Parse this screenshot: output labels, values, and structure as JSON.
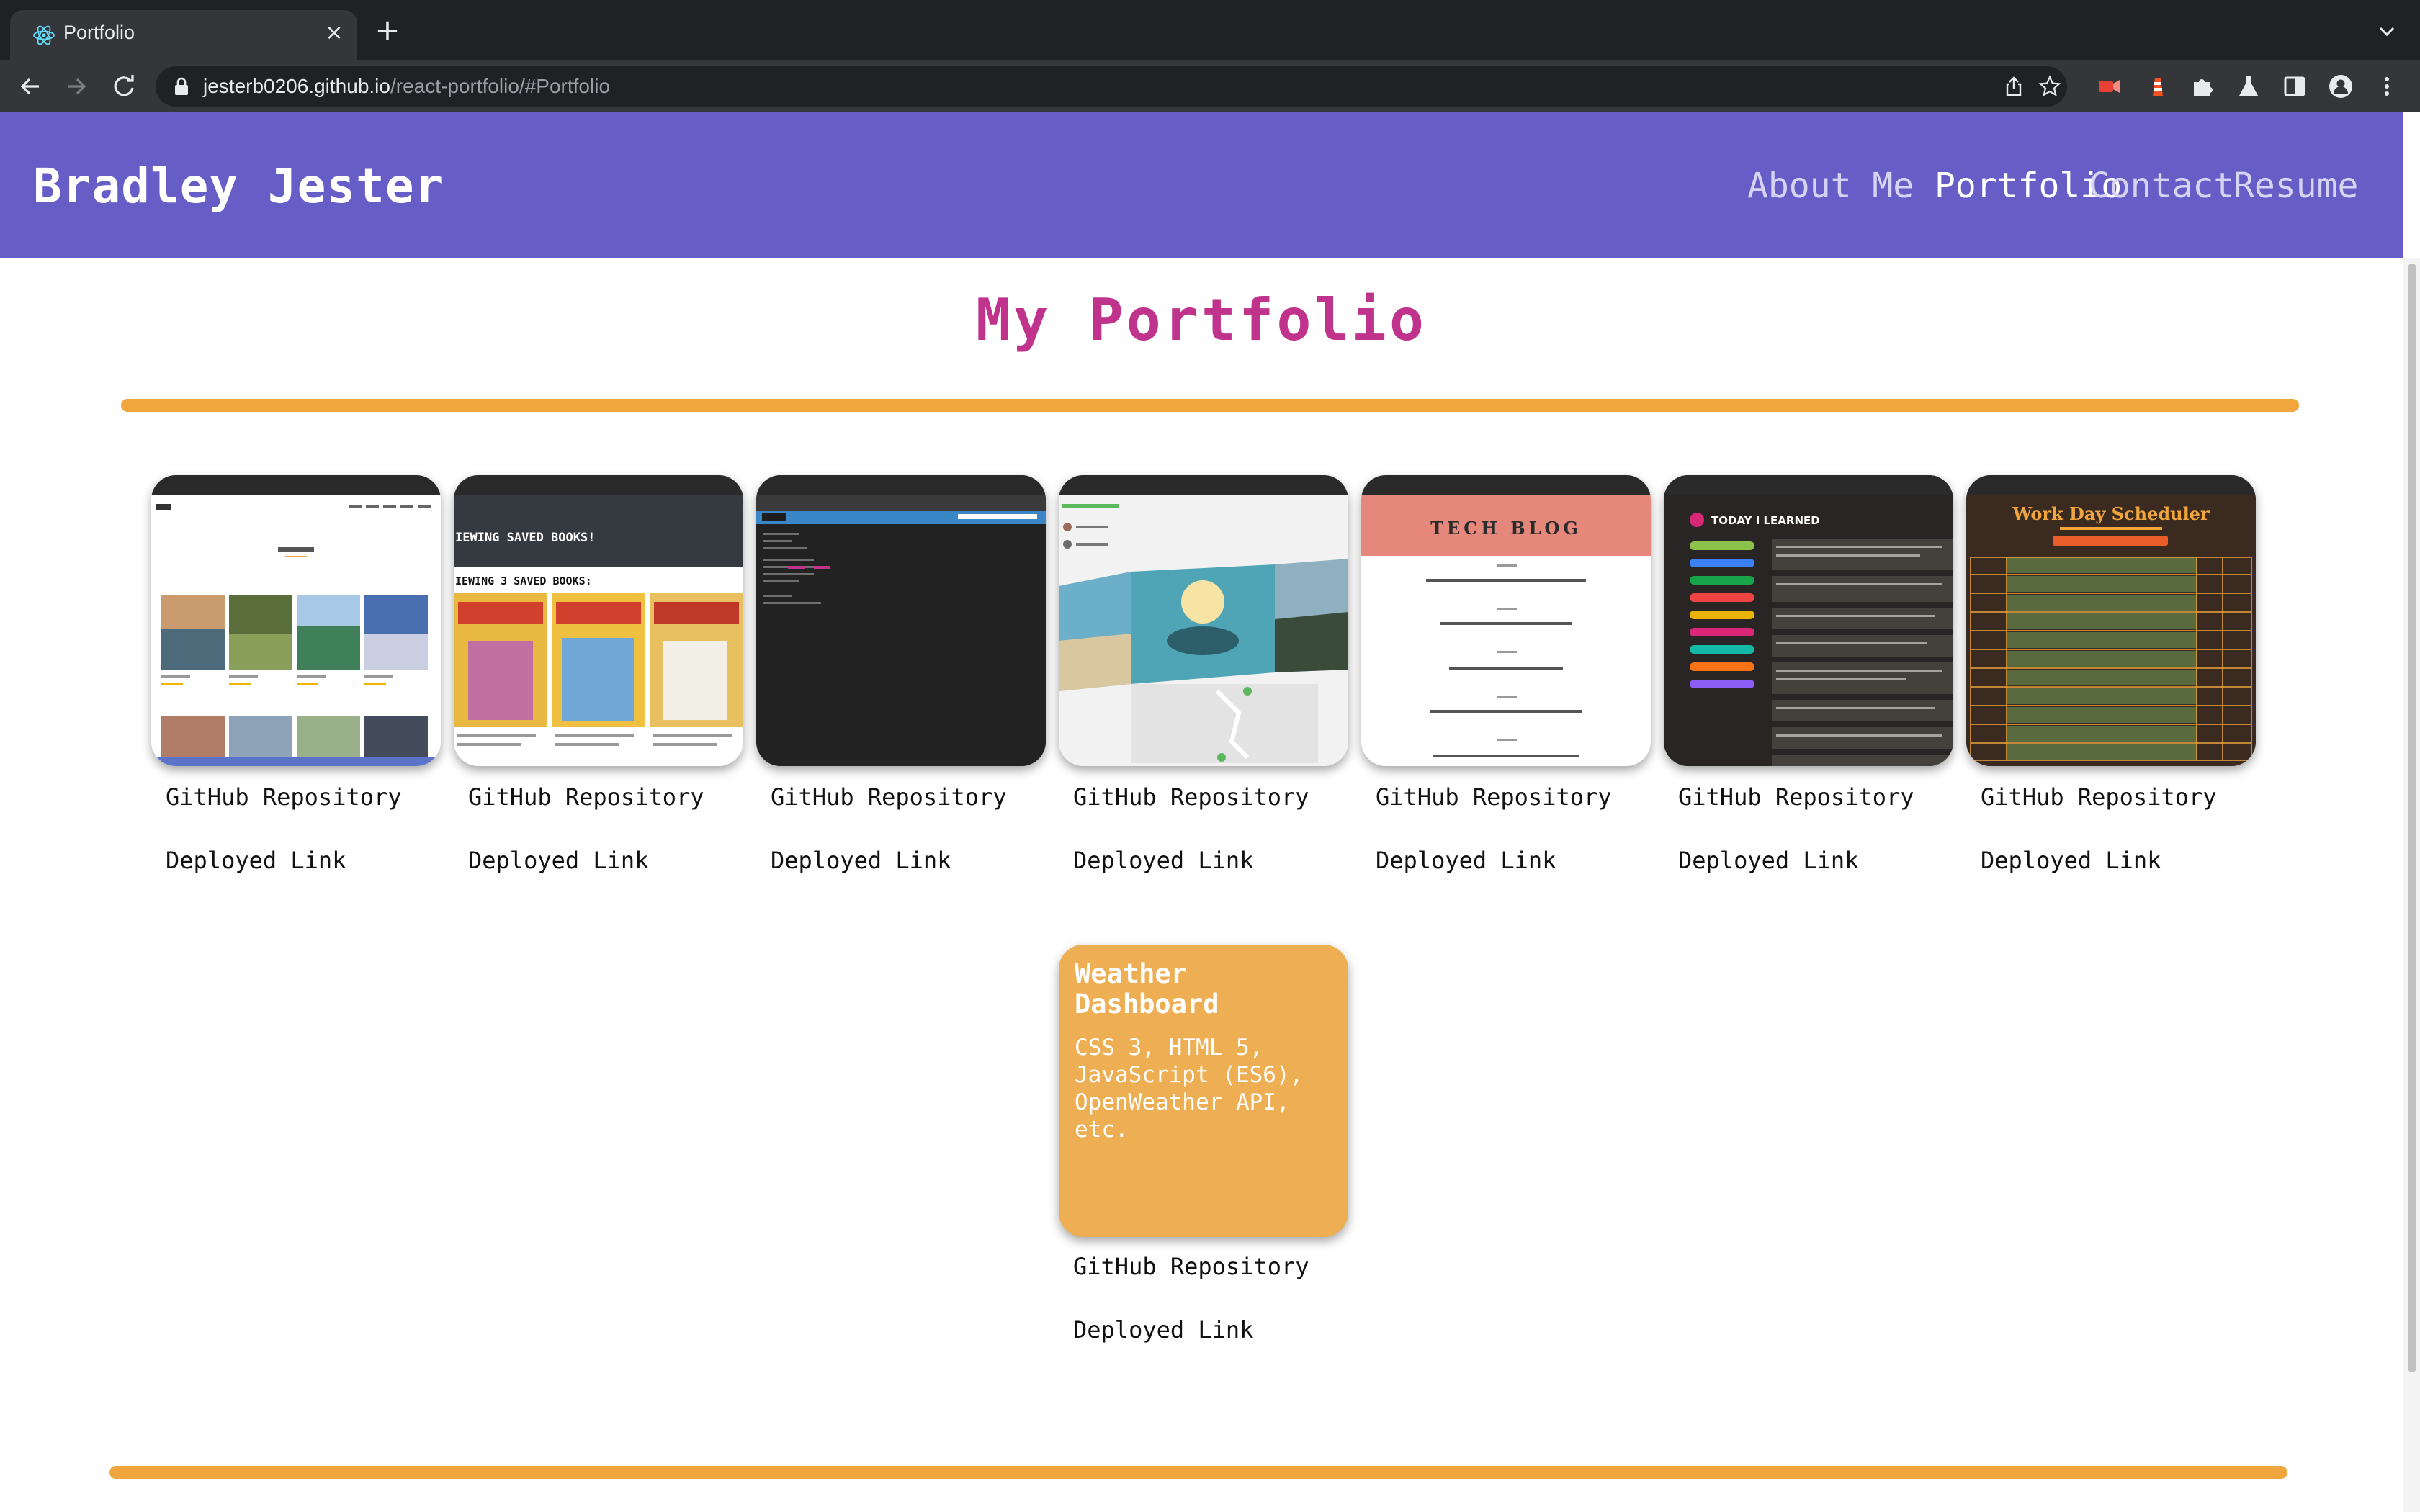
{
  "browser": {
    "tab_title": "Portfolio",
    "url_host": "jesterb0206.github.io",
    "url_path": "/react-portfolio/#Portfolio"
  },
  "header": {
    "brand": "Bradley Jester",
    "nav": [
      "About Me",
      "Portfolio",
      "Contact",
      "Resume"
    ],
    "active_nav": "Portfolio"
  },
  "main": {
    "title": "My Portfolio",
    "accent_color": "#f0a63c",
    "title_color": "#c0338d",
    "header_color": "#665dc7",
    "projects": [
      {
        "github_label": "GitHub Repository",
        "deployed_label": "Deployed Link",
        "thumb_heading": "All Products"
      },
      {
        "github_label": "GitHub Repository",
        "deployed_label": "Deployed Link",
        "thumb_heading": "VIEWING SAVED BOOKS!"
      },
      {
        "github_label": "GitHub Repository",
        "deployed_label": "Deployed Link",
        "thumb_heading": "Just Another Text Editor"
      },
      {
        "github_label": "GitHub Repository",
        "deployed_label": "Deployed Link",
        "thumb_heading": "YOUR TOUR GUIDES"
      },
      {
        "github_label": "GitHub Repository",
        "deployed_label": "Deployed Link",
        "thumb_heading": "TECH BLOG"
      },
      {
        "github_label": "GitHub Repository",
        "deployed_label": "Deployed Link",
        "thumb_heading": "TODAY I LEARNED"
      },
      {
        "github_label": "GitHub Repository",
        "deployed_label": "Deployed Link",
        "thumb_heading": "Work Day Scheduler"
      },
      {
        "github_label": "GitHub Repository",
        "deployed_label": "Deployed Link",
        "title": "Weather Dashboard",
        "tech": "CSS 3, HTML 5, JavaScript (ES6), OpenWeather API, etc."
      }
    ]
  }
}
